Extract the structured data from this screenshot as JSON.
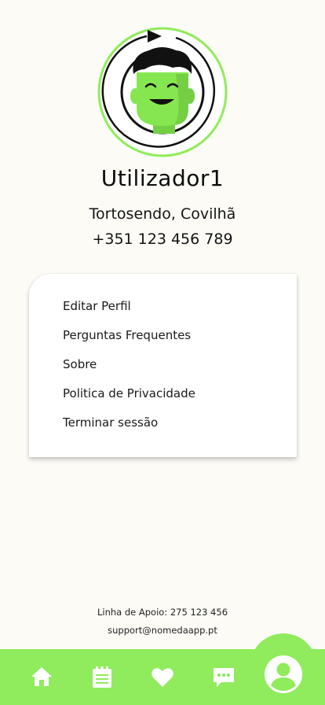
{
  "profile": {
    "username": "Utilizador1",
    "location": "Tortosendo, Covilhã",
    "phone": "+351 123 456 789",
    "avatar_icon": "user-avatar-icon"
  },
  "menu": {
    "items": [
      {
        "label": "Editar Perfil"
      },
      {
        "label": "Perguntas Frequentes"
      },
      {
        "label": "Sobre"
      },
      {
        "label": "Politica de Privacidade"
      },
      {
        "label": "Terminar sessão"
      }
    ]
  },
  "support": {
    "line": "Linha de Apoio: 275 123 456",
    "email": "support@nomedaapp.pt"
  },
  "bottom_nav": {
    "items": [
      {
        "icon": "home-icon"
      },
      {
        "icon": "calendar-icon"
      },
      {
        "icon": "heart-icon"
      },
      {
        "icon": "chat-icon"
      },
      {
        "icon": "profile-icon",
        "active": true
      }
    ]
  },
  "colors": {
    "accent": "#90ec5d",
    "background": "#fcfbf6",
    "face": "#86e64f"
  }
}
